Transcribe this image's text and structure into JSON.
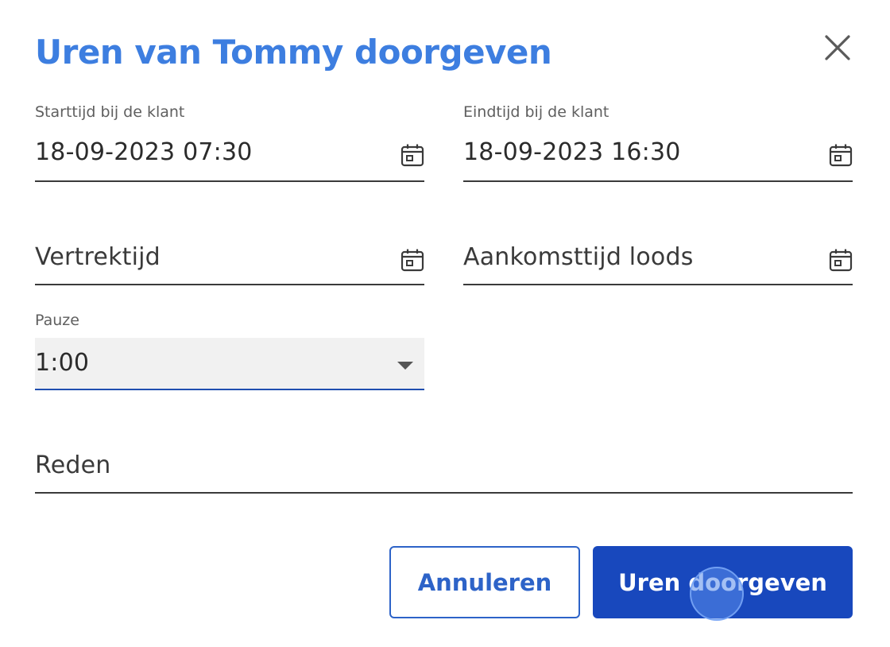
{
  "dialog": {
    "title": "Uren van Tommy doorgeven",
    "close_icon": "close-icon"
  },
  "fields": {
    "start": {
      "label": "Starttijd bij de klant",
      "value": "18-09-2023 07:30",
      "icon": "calendar-icon"
    },
    "end": {
      "label": "Eindtijd bij de klant",
      "value": "18-09-2023 16:30",
      "icon": "calendar-icon"
    },
    "departure": {
      "placeholder": "Vertrektijd",
      "icon": "calendar-icon"
    },
    "arrival": {
      "placeholder": "Aankomsttijd loods",
      "icon": "calendar-icon"
    },
    "pause": {
      "label": "Pauze",
      "value": "1:00",
      "icon": "chevron-down-icon"
    },
    "reason": {
      "placeholder": "Reden"
    }
  },
  "actions": {
    "cancel_label": "Annuleren",
    "submit_label": "Uren doorgeven"
  },
  "colors": {
    "title": "#3d7ee0",
    "primary": "#1848bd",
    "outline": "#2d63c8",
    "select_background": "#f1f1f1"
  }
}
